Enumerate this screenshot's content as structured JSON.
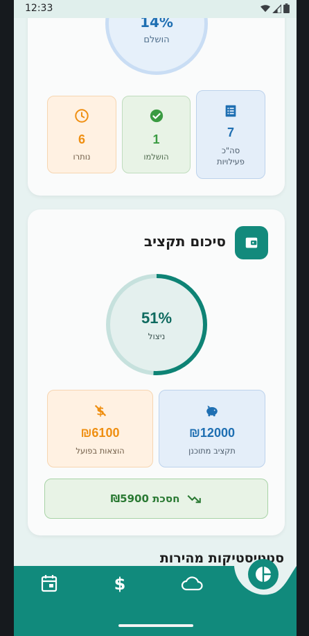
{
  "status_bar": {
    "time": "12:33"
  },
  "progress": {
    "percent": "14%",
    "label": "הושלם"
  },
  "activity_stats": [
    {
      "key": "total",
      "value": "7",
      "label": "סה\"כ פעילויות",
      "color": "#1f6fb2"
    },
    {
      "key": "done",
      "value": "1",
      "label": "הושלמו",
      "color": "#3a9b42"
    },
    {
      "key": "remaining",
      "value": "6",
      "label": "נותרו",
      "color": "#ef8f12"
    }
  ],
  "budget": {
    "title": "סיכום תקציב",
    "used_percent": "51%",
    "used_fraction": 0.51,
    "used_label": "ניצול",
    "planned": {
      "value": "₪12000",
      "label": "תקציב מתוכנן",
      "icon": "piggy-bank-icon",
      "color": "#1f6fb2"
    },
    "actual": {
      "value": "₪6100",
      "label": "הוצאות בפועל",
      "icon": "money-off-icon",
      "color": "#ef8f12"
    },
    "savings": {
      "text": "חסכת ₪5900",
      "icon": "trending-down-icon",
      "color": "#2b7a34"
    }
  },
  "quick_stats": {
    "title": "סטטיסטיקות מהירות"
  },
  "bottom_nav": {
    "items": [
      {
        "key": "calendar",
        "icon": "calendar-icon"
      },
      {
        "key": "budget",
        "icon": "dollar-icon"
      },
      {
        "key": "weather",
        "icon": "cloud-icon"
      },
      {
        "key": "summary",
        "icon": "pie-chart-icon",
        "active": true
      }
    ]
  },
  "colors": {
    "accent": "#118a7c",
    "nav_background": "#118a7c"
  }
}
